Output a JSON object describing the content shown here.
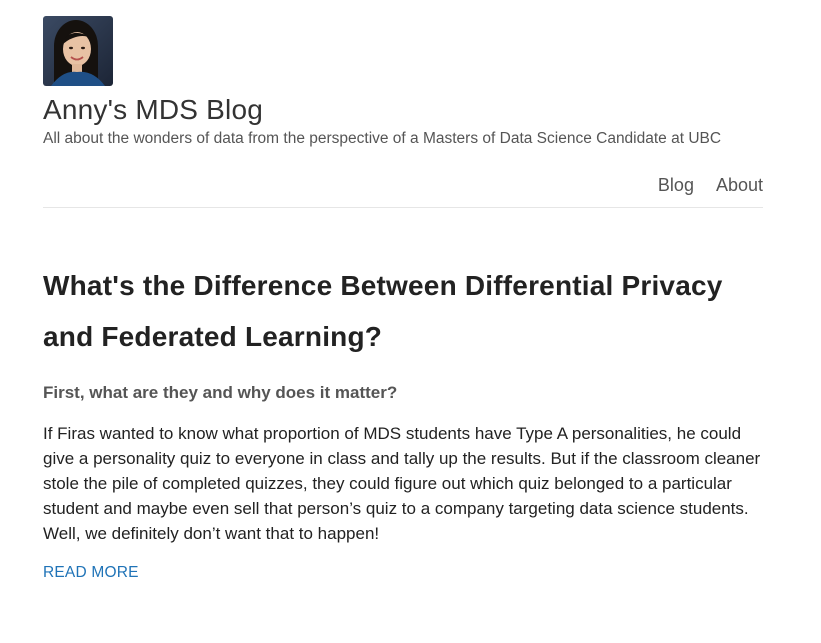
{
  "header": {
    "site_title": "Anny's MDS Blog",
    "tagline": "All about the wonders of data from the perspective of a Masters of Data Science Candidate at UBC"
  },
  "nav": {
    "items": [
      {
        "label": "Blog"
      },
      {
        "label": "About"
      }
    ]
  },
  "post": {
    "title": "What's the Difference Between Differential Privacy and Federated Learning?",
    "subtitle": "First, what are they and why does it matter?",
    "excerpt": "If Firas wanted to know what proportion of MDS students have Type A personalities, he could give a personality quiz to everyone in class and tally up the results. But if the classroom cleaner stole the pile of completed quizzes, they could figure out which quiz belonged to a particular student and maybe even sell that person’s quiz to a company targeting data science students. Well, we definitely don’t want that to happen!",
    "read_more": "READ MORE"
  },
  "colors": {
    "link": "#1f73b7",
    "text": "#222222",
    "muted": "#555555"
  }
}
